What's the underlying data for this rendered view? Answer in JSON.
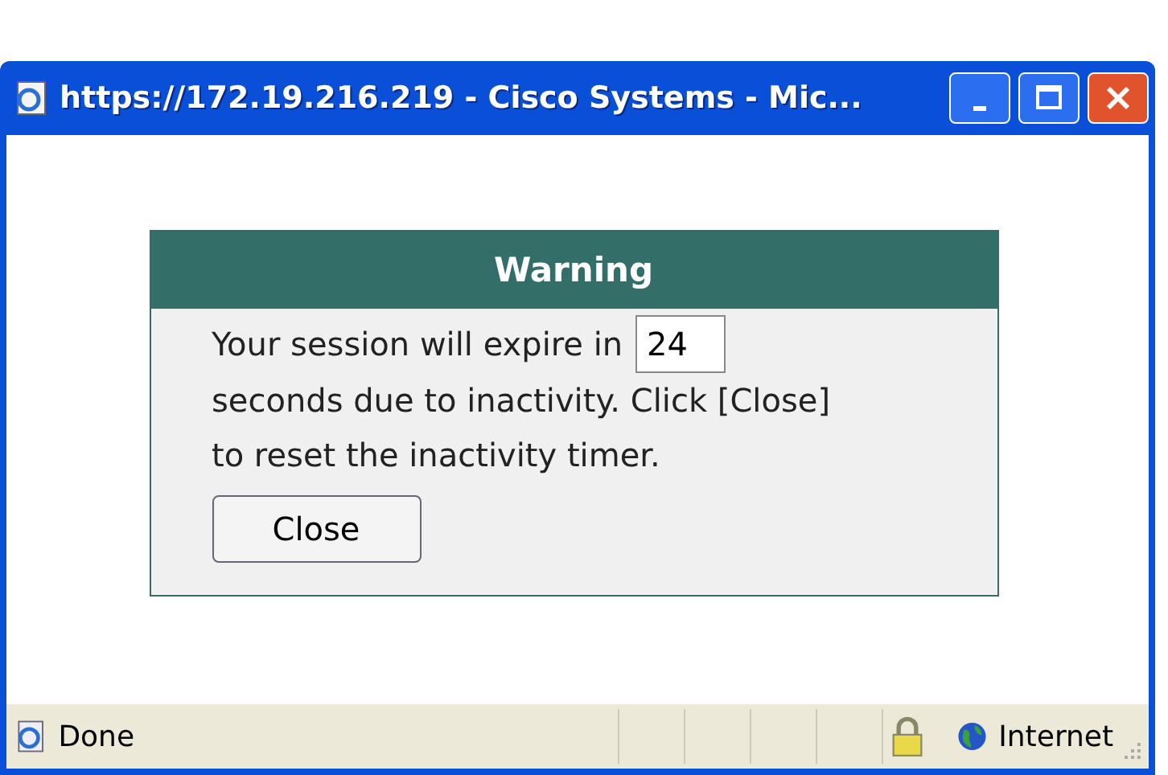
{
  "window": {
    "title": "https://172.19.216.219 - Cisco Systems - Mic..."
  },
  "dialog": {
    "title": "Warning",
    "text_before": "Your session will expire in",
    "countdown": "24",
    "text_after": "seconds due to inactivity. Click [Close] to reset the inactivity timer.",
    "button": "Close"
  },
  "status_bar": {
    "status": "Done",
    "zone": "Internet",
    "secure": true
  }
}
